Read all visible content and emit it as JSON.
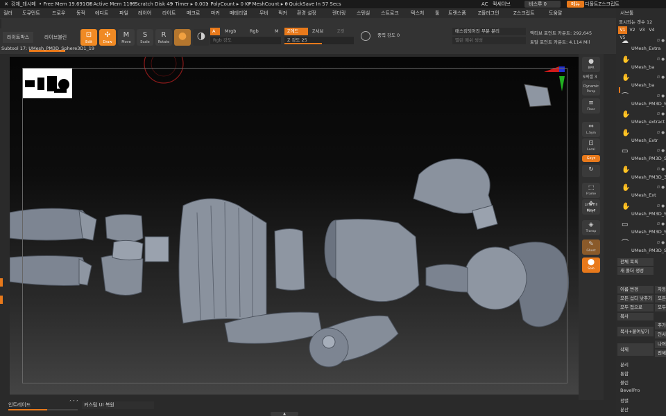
{
  "status_bar": {
    "title": "강체_데시메",
    "free_mem": "• Free Mem 19.691GB",
    "active_mem": "• Active Mem 1169",
    "scratch_disk": "• Scratch Disk 49",
    "timer": "• Timer ▸ 0.001",
    "poly_count": "• PolyCount ▸ 0 KP",
    "mesh_count": "• MeshCount ▸ 0",
    "quicksave": "• QuickSave In 57 Secs",
    "ac": "AC",
    "autosave": "퀵세이브",
    "see_through": "비스루 0",
    "menu_pill": "메뉴",
    "default_script": "디폴트Z스크립트"
  },
  "menus": [
    "컬러",
    "도큐먼트",
    "드로우",
    "동적",
    "에디트",
    "파일",
    "레이어",
    "라이트",
    "매크로",
    "마커",
    "매테리얼",
    "무비",
    "픽커",
    "환경 설정",
    "렌더링",
    "스텐실",
    "스트로크",
    "텍스처",
    "툴",
    "트랜스폼",
    "Z플러그인",
    "Z스크립트",
    "도움말"
  ],
  "toolbar": {
    "tab_lightbox": "라이트박스",
    "tab_livebool": "라이브불린",
    "edit": "Edit",
    "draw": "Draw",
    "move": "Move",
    "scale": "Scale",
    "rotate": "Rotate",
    "a_btn": "A",
    "mrgb": "Mrgb",
    "rgb": "Rgb",
    "m_btn": "M",
    "rgb_intensity": "Rgb 강도",
    "zadd": "Z에드",
    "zsub": "Z서브",
    "zcut": "Z컷",
    "z_intensity": "Z 강도 25",
    "focal_shift": "중력 강도 0",
    "mask_split": "매스킹되어진 부분 분리",
    "split_unmasked": "별린 매쉬 생성",
    "active_points": "액티브 포인트 카운트: 292,645",
    "total_points": "토탈 포인트 카운트: 4.114 Mil"
  },
  "subtool_line": "Subtool 17:  UMesh_PM3D_Sphere3D1_19",
  "shelf": {
    "bpr": "BPR",
    "spix": "S픽셀 3",
    "dynamic": "Dynamic",
    "persp": "Persp",
    "floor": "Floor",
    "xyz": "L.Sym",
    "local": "Local",
    "frame": "Frame",
    "move": "Move",
    "line_fill": "Line Fill",
    "polyf": "PolyF",
    "transp": "Transp",
    "ghost": "Ghost",
    "solo": "Solo",
    "xyz_on": "Gxyz"
  },
  "subtool_panel": {
    "title": "서브툴",
    "visible_count": "표시되는 갯수 12",
    "version_tabs": [
      "V1",
      "V2",
      "V3",
      "V4",
      "V5"
    ],
    "items": [
      {
        "name": "UMesh_Extra"
      },
      {
        "name": "UMesh_ba"
      },
      {
        "name": "UMesh_ba"
      },
      {
        "name": "UMesh_PM3D_Sp"
      },
      {
        "name": "UMesh_extract"
      },
      {
        "name": "UMesh_Extr"
      },
      {
        "name": "UMesh_PM3D_Sp"
      },
      {
        "name": "UMesh_PM3D_3"
      },
      {
        "name": "UMesh_Ext"
      },
      {
        "name": "UMesh_PM3D_Sp"
      },
      {
        "name": "UMesh_PM3D_Sp"
      },
      {
        "name": "UMesh_PM3D_Sp"
      }
    ],
    "toggle_glyphs": "∅ ●",
    "all_list": "전체 목록",
    "new_folder": "새 폴더 생성",
    "rename": "이름 변경",
    "auto_reorder": "자동",
    "all_low": "모든 섭디 낮추기",
    "all_high": "모든",
    "all_close": "모두 접으로",
    "all_open": "모두",
    "copy": "복사",
    "copy_paste": "복사+붙여넣기",
    "append": "추가",
    "insert": "인서",
    "delete": "삭제",
    "others": "나머",
    "all": "전체",
    "split": "분리",
    "merge": "통합",
    "boolean": "불린",
    "bevelpro": "BevelPro",
    "align": "정렬",
    "distribute": "분산"
  },
  "bottom_bar": {
    "intro_mode": "인트레이드",
    "custom_ui_restore": "커스텀 UI 복원"
  }
}
